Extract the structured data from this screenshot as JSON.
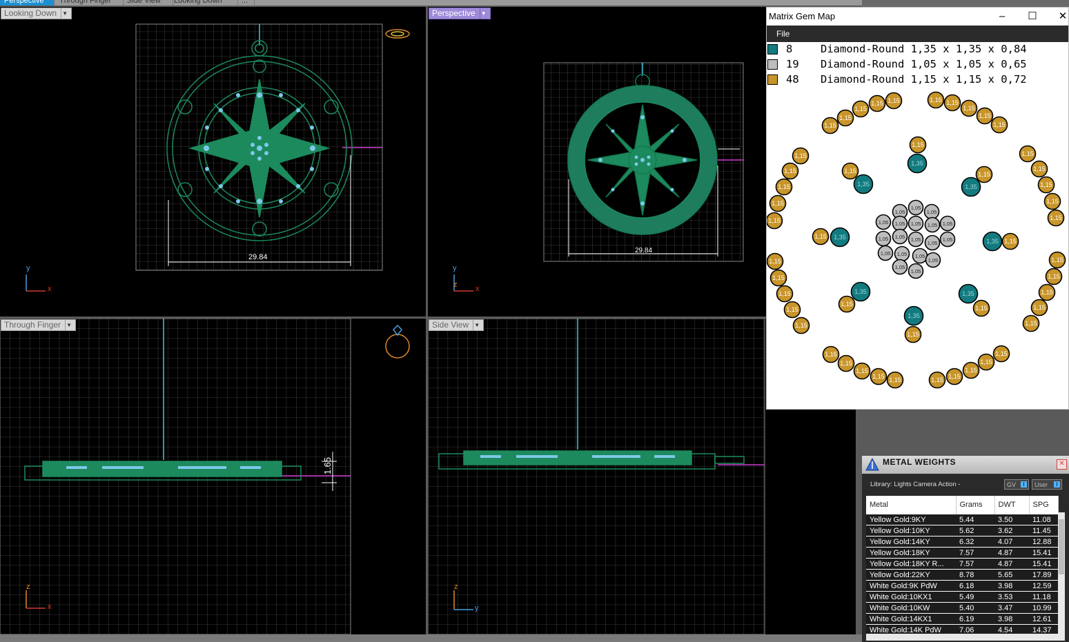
{
  "tabs": [
    "Perspective",
    "Through Finger",
    "Side View",
    "Looking Down",
    "..."
  ],
  "viewports": {
    "top_left": {
      "label": "Looking Down",
      "dimension": "29.84",
      "axis_v": "y",
      "axis_h": "x"
    },
    "top_right": {
      "label": "Perspective",
      "dimension": "29.84",
      "axis_v": "y",
      "axis_h": "x",
      "axis_z": "z"
    },
    "bottom_left": {
      "label": "Through Finger",
      "dimension": "1.65",
      "axis_v": "z",
      "axis_h": "x"
    },
    "bottom_right": {
      "label": "Side View",
      "axis_v": "z",
      "axis_h": "y"
    }
  },
  "gem_map": {
    "title": "Matrix Gem Map",
    "menu": "File",
    "window_buttons": {
      "minimize": "–",
      "maximize": "☐",
      "close": "✕"
    },
    "legend": [
      {
        "count": "8",
        "desc": "Diamond-Round 1,35 x 1,35 x 0,84",
        "color": "#137b7f"
      },
      {
        "count": "19",
        "desc": "Diamond-Round 1,05 x 1,05 x 0,65",
        "color": "#bdbdbd"
      },
      {
        "count": "48",
        "desc": "Diamond-Round 1,15 x 1,15 x 0,72",
        "color": "#c8952a"
      }
    ],
    "labels": {
      "teal": "1,35",
      "gray": "1,05",
      "gold": "1,15"
    }
  },
  "metal_weights": {
    "title": "METAL WEIGHTS",
    "close": "✕",
    "library": "Library: Lights Camera Action -",
    "btn_gv": "GV",
    "btn_user": "User",
    "btn_indicator": "I",
    "columns": [
      "Metal",
      "Grams",
      "DWT",
      "SPG"
    ],
    "rows": [
      [
        "Yellow Gold:9KY",
        "5.44",
        "3.50",
        "11.08"
      ],
      [
        "Yellow Gold:10KY",
        "5.62",
        "3.62",
        "11.45"
      ],
      [
        "Yellow Gold:14KY",
        "6.32",
        "4.07",
        "12.88"
      ],
      [
        "Yellow Gold:18KY",
        "7.57",
        "4.87",
        "15.41"
      ],
      [
        "Yellow Gold:18KY R...",
        "7.57",
        "4.87",
        "15.41"
      ],
      [
        "Yellow Gold:22KY",
        "8.78",
        "5.65",
        "17.89"
      ],
      [
        "White Gold:9K PdW",
        "6.18",
        "3.98",
        "12.59"
      ],
      [
        "White Gold:10KX1",
        "5.49",
        "3.53",
        "11.18"
      ],
      [
        "White Gold:10KW",
        "5.40",
        "3.47",
        "10.99"
      ],
      [
        "White Gold:14KX1",
        "6.19",
        "3.98",
        "12.61"
      ],
      [
        "White Gold:14K PdW",
        "7.06",
        "4.54",
        "14.37"
      ]
    ]
  }
}
